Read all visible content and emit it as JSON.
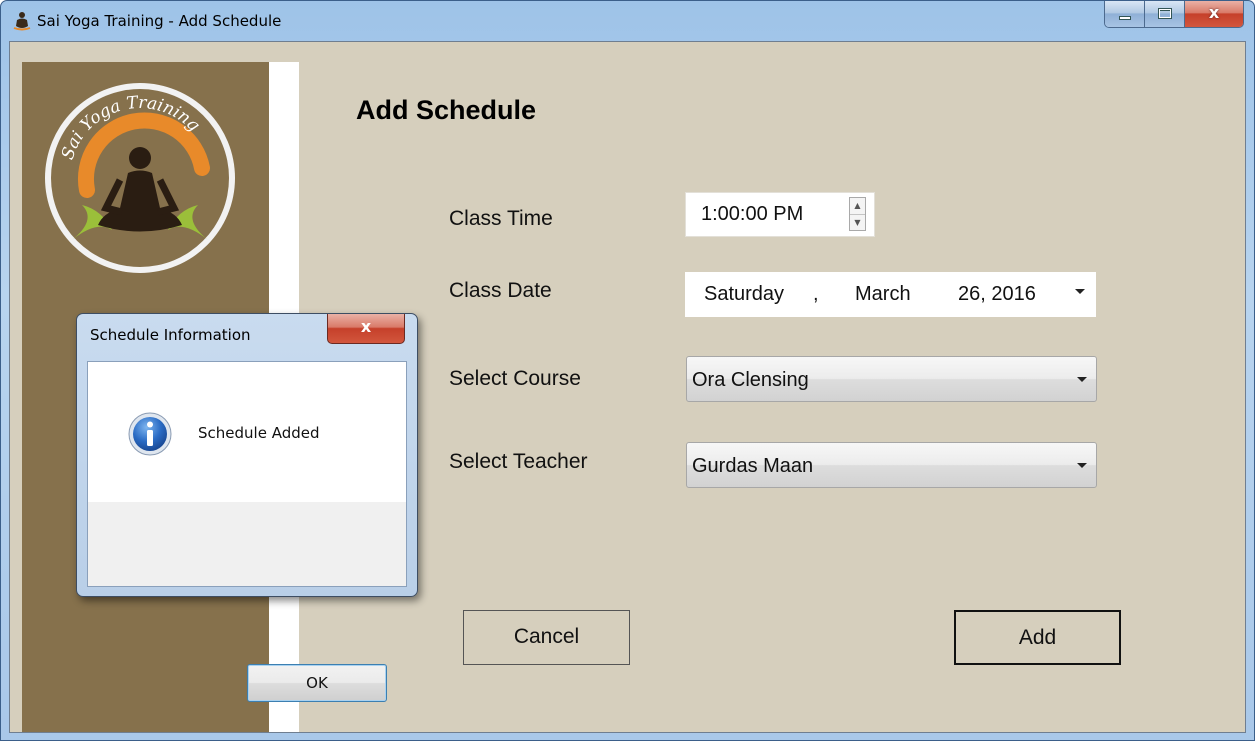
{
  "window": {
    "title": "Sai Yoga Training - Add Schedule",
    "close_glyph": "x"
  },
  "logo": {
    "text": "Sai Yoga Training"
  },
  "form": {
    "title": "Add Schedule",
    "class_time": {
      "label": "Class Time",
      "value": "1:00:00 PM"
    },
    "class_date": {
      "label": "Class Date",
      "weekday": "Saturday",
      "comma": ",",
      "month": "March",
      "day_year": "26, 2016"
    },
    "course": {
      "label": "Select Course",
      "value": "Ora Clensing"
    },
    "teacher": {
      "label": "Select Teacher",
      "value": "Gurdas Maan"
    },
    "cancel_label": "Cancel",
    "add_label": "Add"
  },
  "dialog": {
    "title": "Schedule Information",
    "close_glyph": "x",
    "message": "Schedule Added",
    "ok_label": "OK",
    "icon": "info-icon"
  },
  "colors": {
    "sidebar": "#86714c",
    "form_background": "#d6cfbd",
    "logo_orange": "#e88a2a"
  }
}
